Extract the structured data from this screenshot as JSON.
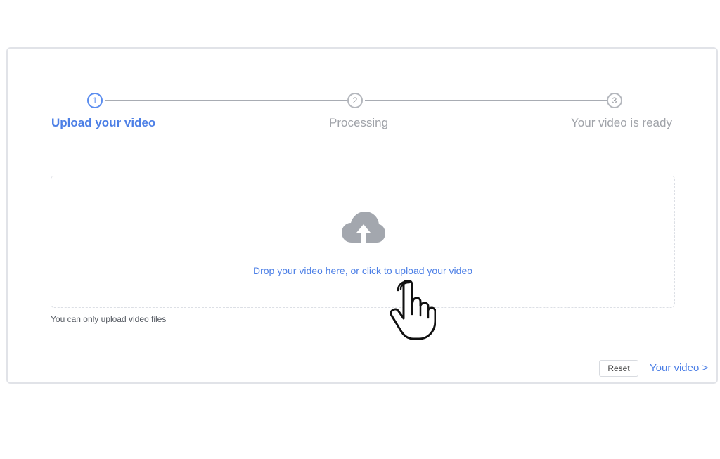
{
  "steps": [
    {
      "number": "1",
      "label": "Upload your video",
      "active": true
    },
    {
      "number": "2",
      "label": "Processing",
      "active": false
    },
    {
      "number": "3",
      "label": "Your video is ready",
      "active": false
    }
  ],
  "upload": {
    "drop_text": "Drop your video here, or click to upload your video",
    "hint": "You can only upload video files",
    "icon": "cloud-upload-icon"
  },
  "footer": {
    "reset_label": "Reset",
    "next_label": "Your video >"
  },
  "colors": {
    "accent": "#4c7fe6",
    "inactive": "#a0a3a9",
    "border": "#e1e3e8"
  }
}
